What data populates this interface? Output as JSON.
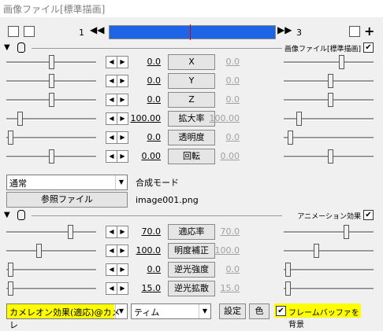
{
  "window": {
    "title": "画像ファイル[標準描画]"
  },
  "toolbar": {
    "frame_start": "1",
    "frame_end": "3",
    "prev_icon": "rewind-icon",
    "next_icon": "fast-forward-icon"
  },
  "sections": {
    "image": {
      "label": "画像ファイル[標準描画]",
      "checked": "✔"
    },
    "animation": {
      "label": "アニメーション効果",
      "checked": "✔"
    }
  },
  "rows": [
    {
      "left": "0.0",
      "param": "X",
      "right": "0.0"
    },
    {
      "left": "0.0",
      "param": "Y",
      "right": "0.0"
    },
    {
      "left": "0.0",
      "param": "Z",
      "right": "0.0"
    },
    {
      "left": "100.00",
      "param": "拡大率",
      "right": "100.00"
    },
    {
      "left": "0.0",
      "param": "透明度",
      "right": "0.0"
    },
    {
      "left": "0.00",
      "param": "回転",
      "right": "0.00"
    }
  ],
  "blend": {
    "value": "通常",
    "label": "合成モード"
  },
  "file": {
    "button": "参照ファイル",
    "name": "image001.png"
  },
  "anim_rows": [
    {
      "left": "70.0",
      "param": "適応率",
      "right": "70.0"
    },
    {
      "left": "100.0",
      "param": "明度補正",
      "right": "100.0"
    },
    {
      "left": "0.0",
      "param": "逆光強度",
      "right": "0.0"
    },
    {
      "left": "15.0",
      "param": "逆光拡散",
      "right": "15.0"
    }
  ],
  "bottom": {
    "effect": "カメレオン効果(適応)@カメレ",
    "target": "ティム",
    "settings": "設定",
    "color": "色",
    "frame_bg": "フレームバッファを背景",
    "highlight": "#ffff00"
  }
}
